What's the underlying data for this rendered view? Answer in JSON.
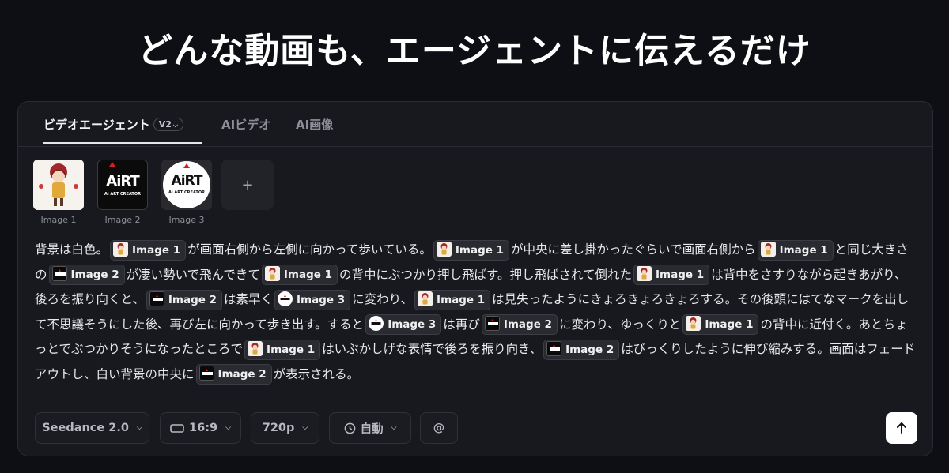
{
  "headline": "どんな動画も、エージェントに伝えるだけ",
  "tabs": [
    {
      "label": "ビデオエージェント",
      "badge": "V2"
    },
    {
      "label": "AIビデオ"
    },
    {
      "label": "AI画像"
    }
  ],
  "images": [
    {
      "label": "Image 1"
    },
    {
      "label": "Image 2",
      "logo": "AiRT",
      "logo_sub": "Ai ART CREATOR"
    },
    {
      "label": "Image 3",
      "logo": "AiRT",
      "logo_sub": "Ai ART CREATOR"
    }
  ],
  "add_button": "+",
  "prompt": {
    "segments": [
      {
        "t": "背景は白色。"
      },
      {
        "chip": "Image 1",
        "img": 1
      },
      {
        "t": "が画面右側から左側に向かって歩いている。"
      },
      {
        "chip": "Image 1",
        "img": 1
      },
      {
        "t": "が中央に差し掛かったぐらいで画面右側から"
      },
      {
        "chip": "Image 1",
        "img": 1
      },
      {
        "t": "と同じ大きさの"
      },
      {
        "chip": "Image 2",
        "img": 2
      },
      {
        "t": "が凄い勢いで飛んできて"
      },
      {
        "chip": "Image 1",
        "img": 1
      },
      {
        "t": "の背中にぶつかり押し飛ばす。押し飛ばされて倒れた"
      },
      {
        "chip": "Image 1",
        "img": 1
      },
      {
        "t": "は背中をさすりながら起きあがり、後ろを振り向くと、"
      },
      {
        "chip": "Image 2",
        "img": 2
      },
      {
        "t": "は素早く"
      },
      {
        "chip": "Image 3",
        "img": 3
      },
      {
        "t": "に変わり、"
      },
      {
        "chip": "Image 1",
        "img": 1
      },
      {
        "t": "は見失ったようにきょろきょろきょろする。その後頭にはてなマークを出して不思議そうにした後、再び左に向かって歩き出す。すると"
      },
      {
        "chip": "Image 3",
        "img": 3
      },
      {
        "t": "は再び"
      },
      {
        "chip": "Image 2",
        "img": 2
      },
      {
        "t": "に変わり、ゆっくりと"
      },
      {
        "chip": "Image 1",
        "img": 1
      },
      {
        "t": "の背中に近付く。あとちょっとでぶつかりそうになったところで"
      },
      {
        "chip": "Image 1",
        "img": 1
      },
      {
        "t": "はいぶかしげな表情で後ろを振り向き、"
      },
      {
        "chip": "Image 2",
        "img": 2
      },
      {
        "t": "はびっくりしたように伸び縮みする。画面はフェードアウトし、白い背景の中央に"
      },
      {
        "chip": "Image 2",
        "img": 2
      },
      {
        "t": "が表示される。"
      }
    ]
  },
  "controls": {
    "model": "Seedance 2.0",
    "ratio": "16:9",
    "resolution": "720p",
    "duration": "自動",
    "mention": "@"
  },
  "icons": {
    "ratio": "aspect-ratio-icon",
    "duration": "clock-icon",
    "send": "arrow-up-icon",
    "dropdown": "chevron-down-icon"
  }
}
